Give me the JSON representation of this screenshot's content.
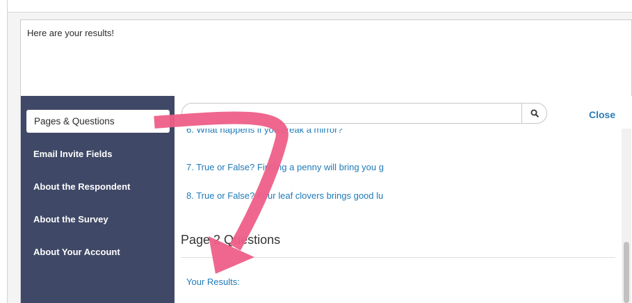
{
  "message": {
    "text": "Here are your results!"
  },
  "sidebar": {
    "items": [
      {
        "label": "Pages & Questions"
      },
      {
        "label": "Email Invite Fields"
      },
      {
        "label": "About the Respondent"
      },
      {
        "label": "About the Survey"
      },
      {
        "label": "About Your Account"
      }
    ]
  },
  "search": {
    "placeholder": "",
    "icon": "search-icon"
  },
  "close_label": "Close",
  "questions": [
    {
      "label": "6. What happens if you break a mirror?"
    },
    {
      "label": "7. True or False? Finding a penny will bring you g"
    },
    {
      "label": "8. True or False? Four leaf clovers brings good lu"
    }
  ],
  "section": {
    "title": "Page 2 Questions"
  },
  "results_link": "Your Results:",
  "colors": {
    "sidebar": "#3f4866",
    "link": "#1e7ab8",
    "arrow": "#ee5f88"
  }
}
